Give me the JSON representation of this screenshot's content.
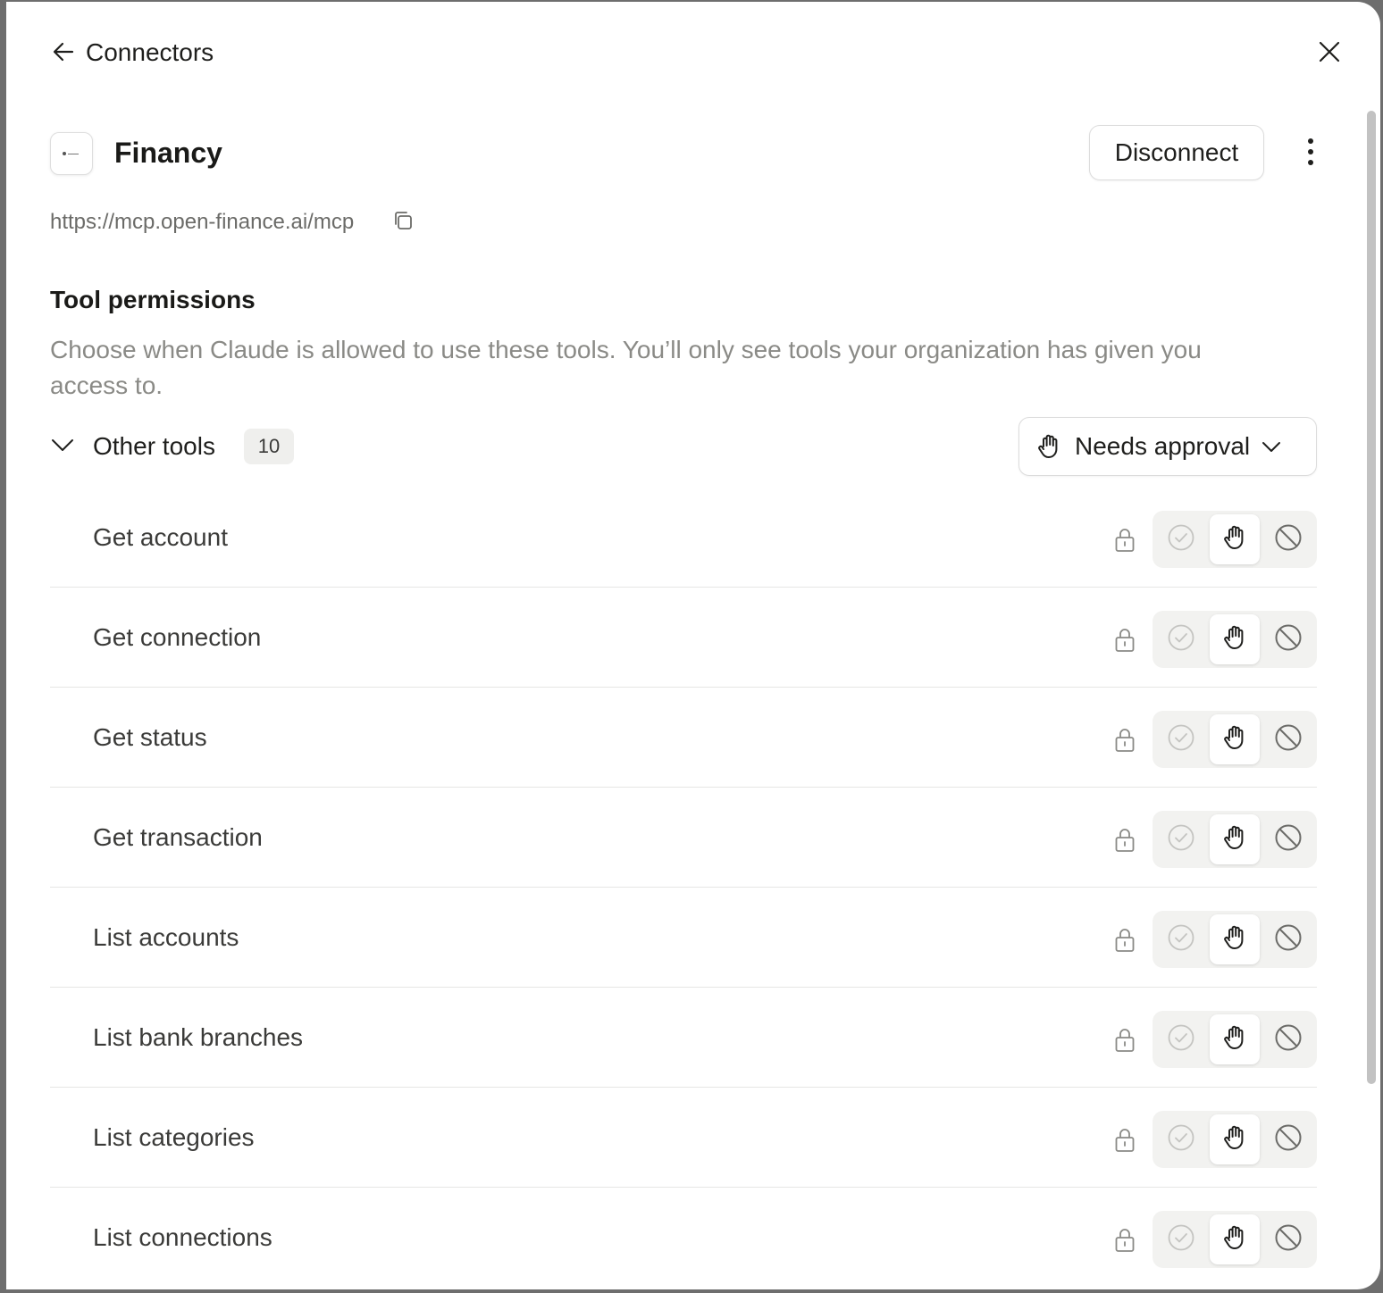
{
  "header": {
    "back_label": "Connectors"
  },
  "connector": {
    "name": "Financy",
    "url": "https://mcp.open-finance.ai/mcp",
    "disconnect_label": "Disconnect"
  },
  "permissions": {
    "title": "Tool permissions",
    "description": "Choose when Claude is allowed to use these tools. You’ll only see tools your organization has given you access to.",
    "group": {
      "label": "Other tools",
      "count": "10",
      "selected_mode": "Needs approval"
    },
    "tools": [
      {
        "name": "Get account",
        "mode": "needs-approval"
      },
      {
        "name": "Get connection",
        "mode": "needs-approval"
      },
      {
        "name": "Get status",
        "mode": "needs-approval"
      },
      {
        "name": "Get transaction",
        "mode": "needs-approval"
      },
      {
        "name": "List accounts",
        "mode": "needs-approval"
      },
      {
        "name": "List bank branches",
        "mode": "needs-approval"
      },
      {
        "name": "List categories",
        "mode": "needs-approval"
      },
      {
        "name": "List connections",
        "mode": "needs-approval"
      }
    ]
  },
  "colors": {
    "accent_text": "#1f1f1d",
    "muted_text": "#8a8a86",
    "segment_bg": "#f2f2f0"
  }
}
